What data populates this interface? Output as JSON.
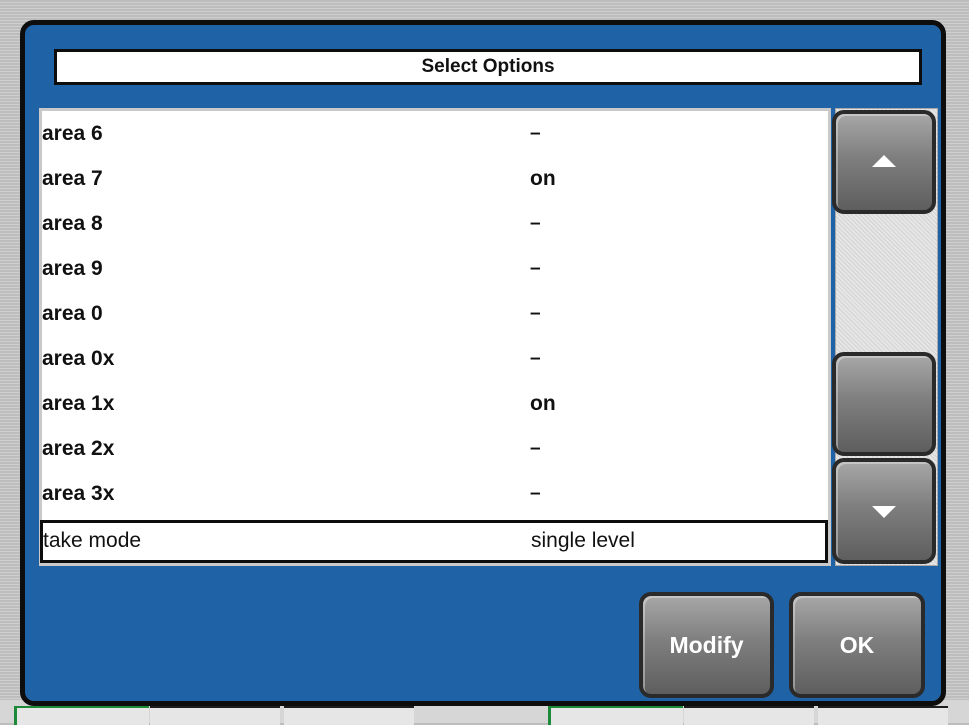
{
  "dialog": {
    "title": "Select Options"
  },
  "options": [
    {
      "name": "area 6",
      "value": "–"
    },
    {
      "name": "area 7",
      "value": "on"
    },
    {
      "name": "area 8",
      "value": "–"
    },
    {
      "name": "area 9",
      "value": "–"
    },
    {
      "name": "area 0",
      "value": "–"
    },
    {
      "name": "area 0x",
      "value": "–"
    },
    {
      "name": "area 1x",
      "value": "on"
    },
    {
      "name": "area 2x",
      "value": "–"
    },
    {
      "name": "area 3x",
      "value": "–"
    },
    {
      "name": "take mode",
      "value": "single level"
    }
  ],
  "selected_option": "take mode",
  "scrollbar": {
    "up_icon": "triangle-up",
    "down_icon": "triangle-down"
  },
  "buttons": {
    "modify_label": "Modify",
    "ok_label": "OK"
  },
  "colors": {
    "dialog_background": "#1f62a6",
    "list_background": "#ffffff",
    "button_gray": "#7f7f7f",
    "frame_border": "#0d0d0d"
  }
}
